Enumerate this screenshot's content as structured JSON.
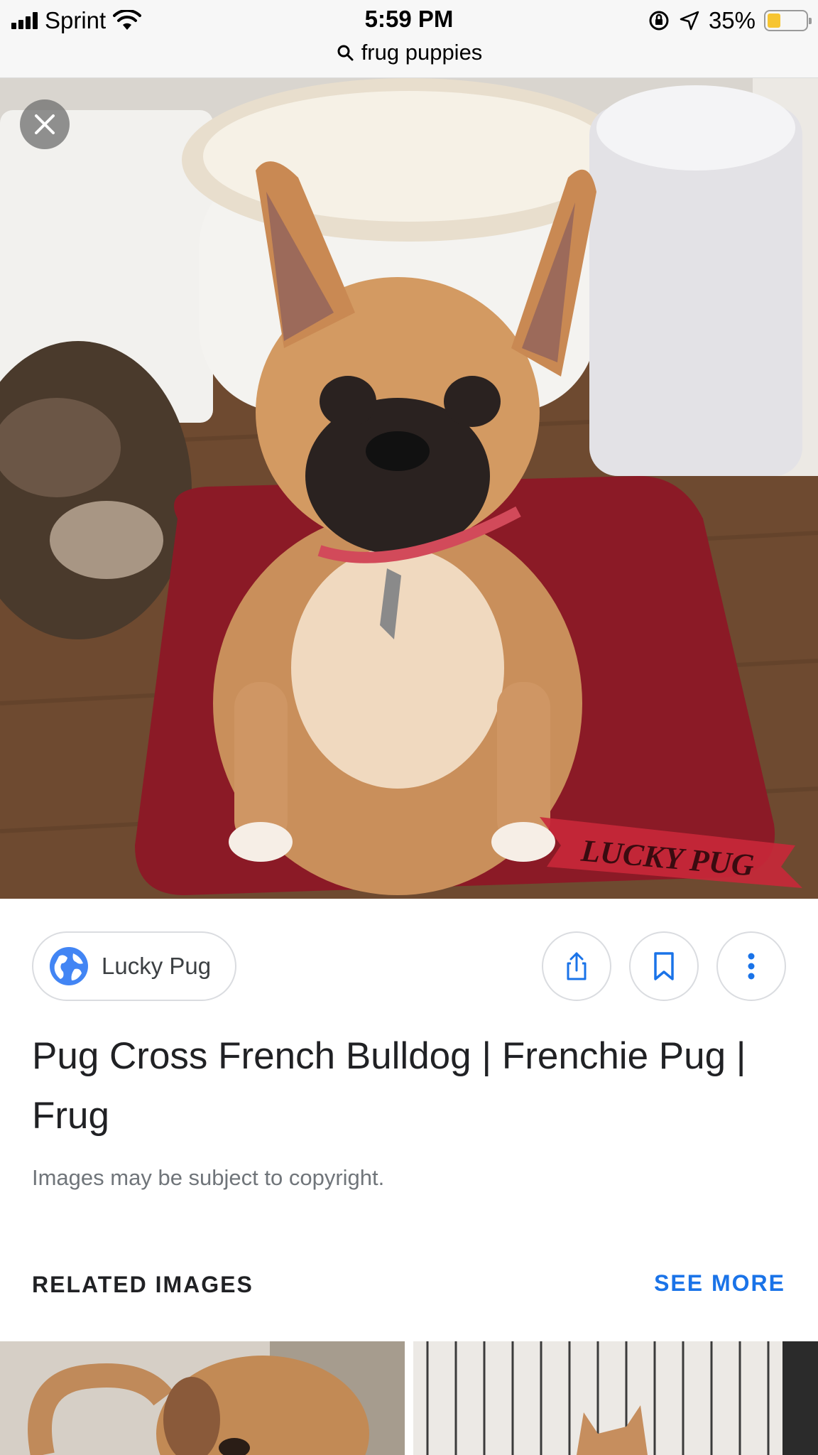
{
  "status_bar": {
    "carrier": "Sprint",
    "time": "5:59 PM",
    "battery_percent": "35%",
    "battery_level": 0.35,
    "battery_color": "#f7c531",
    "icons": [
      "signal-bars-icon",
      "wifi-icon",
      "orientation-lock-icon",
      "location-arrow-icon",
      "battery-icon"
    ]
  },
  "url_bar": {
    "query": "frug puppies",
    "icon": "search-icon"
  },
  "hero_image": {
    "close_icon": "close-icon",
    "watermark_text": "LUCKY PUG"
  },
  "source": {
    "name": "Lucky Pug",
    "icon": "globe-icon",
    "icon_color": "#4285f4"
  },
  "actions": {
    "share_icon": "share-icon",
    "save_icon": "bookmark-icon",
    "more_icon": "more-vert-icon",
    "icon_color": "#1a73e8"
  },
  "result": {
    "title": "Pug Cross French Bulldog | Frenchie Pug | Frug",
    "copyright_note": "Images may be subject to copyright."
  },
  "related": {
    "heading": "RELATED IMAGES",
    "see_more": "SEE MORE",
    "accent_color": "#1a73e8"
  }
}
